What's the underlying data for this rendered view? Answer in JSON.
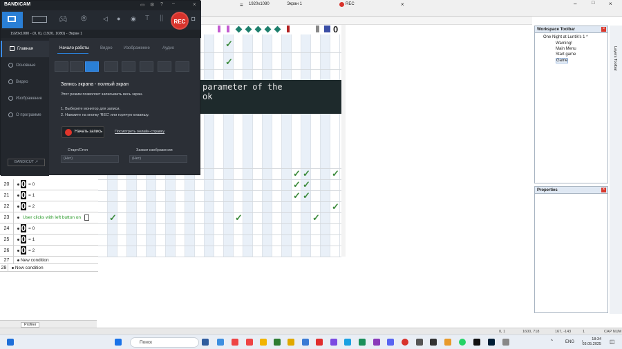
{
  "bandicam": {
    "logo": "BANDICAM",
    "rec_label": "REC",
    "path": "1920x1080 - (0, 0), (1920, 1080) - Экран 1",
    "sidebar": [
      "Главная",
      "Основные",
      "Видео",
      "Изображение",
      "О программе"
    ],
    "bandicut": "BANDICUT ↗",
    "tabs": [
      "Начало работы",
      "Видео",
      "Изображение",
      "Аудио"
    ],
    "heading": "Запись экрана - полный экран",
    "desc": "Этот режим позволяет записывать весь экран.",
    "step1": "1. Выберите монитор для записи.",
    "step2": "2. Нажмите на кнопку 'REC' или горячую клавишу.",
    "start_button": "Начать запись",
    "help_link": "Посмотреть онлайн-справку",
    "hotkey_label_1": "Старт/Стоп",
    "hotkey_label_2": "Захват изображения",
    "hotkey_val_1": "(Нет)",
    "hotkey_val_2": "(Нет)"
  },
  "recbar": {
    "resolution": "1920x1080",
    "screen": "Экран 1",
    "rec": "REC"
  },
  "banner": {
    "line1": "parameter of the",
    "line2": "ok"
  },
  "events": [
    {
      "num": "20",
      "value": "= 0"
    },
    {
      "num": "21",
      "value": "= 1"
    },
    {
      "num": "22",
      "value": "= 2"
    },
    {
      "num": "23",
      "text": "User clicks with left button on"
    },
    {
      "num": "24",
      "value": "= 0"
    },
    {
      "num": "25",
      "value": "= 1"
    },
    {
      "num": "26",
      "value": "= 2"
    },
    {
      "num": "27",
      "text": "New condition"
    },
    {
      "num": "28",
      "text": "New condition"
    }
  ],
  "workspace": {
    "title": "Workspace Toolbar",
    "root": "One Night at Luntik's 1 *",
    "items": [
      "Warning!",
      "Main Menu",
      "Start game",
      "Game"
    ]
  },
  "properties": {
    "title": "Properties"
  },
  "right_strip": "Layers Toolbar",
  "profiler": "Profiler",
  "status": {
    "coords": "0, 1",
    "size": "1600, 718",
    "pos": "167, -143",
    "layer": "1",
    "mode": "CAP NUM"
  },
  "taskbar": {
    "search": "Поиск",
    "lang": "ENG",
    "time": "18:34",
    "date": "03.05.2025"
  },
  "colors": {
    "accent": "#2a7fd6",
    "rec": "#d8322b",
    "check": "#3c8b3c"
  }
}
